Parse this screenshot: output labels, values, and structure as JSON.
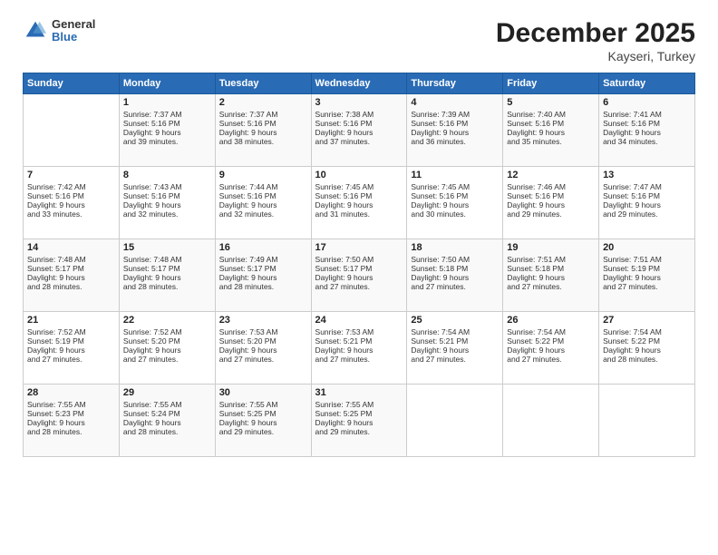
{
  "header": {
    "logo_general": "General",
    "logo_blue": "Blue",
    "month": "December 2025",
    "location": "Kayseri, Turkey"
  },
  "days_of_week": [
    "Sunday",
    "Monday",
    "Tuesday",
    "Wednesday",
    "Thursday",
    "Friday",
    "Saturday"
  ],
  "weeks": [
    [
      {
        "day": "",
        "content": ""
      },
      {
        "day": "1",
        "content": "Sunrise: 7:37 AM\nSunset: 5:16 PM\nDaylight: 9 hours\nand 39 minutes."
      },
      {
        "day": "2",
        "content": "Sunrise: 7:37 AM\nSunset: 5:16 PM\nDaylight: 9 hours\nand 38 minutes."
      },
      {
        "day": "3",
        "content": "Sunrise: 7:38 AM\nSunset: 5:16 PM\nDaylight: 9 hours\nand 37 minutes."
      },
      {
        "day": "4",
        "content": "Sunrise: 7:39 AM\nSunset: 5:16 PM\nDaylight: 9 hours\nand 36 minutes."
      },
      {
        "day": "5",
        "content": "Sunrise: 7:40 AM\nSunset: 5:16 PM\nDaylight: 9 hours\nand 35 minutes."
      },
      {
        "day": "6",
        "content": "Sunrise: 7:41 AM\nSunset: 5:16 PM\nDaylight: 9 hours\nand 34 minutes."
      }
    ],
    [
      {
        "day": "7",
        "content": "Sunrise: 7:42 AM\nSunset: 5:16 PM\nDaylight: 9 hours\nand 33 minutes."
      },
      {
        "day": "8",
        "content": "Sunrise: 7:43 AM\nSunset: 5:16 PM\nDaylight: 9 hours\nand 32 minutes."
      },
      {
        "day": "9",
        "content": "Sunrise: 7:44 AM\nSunset: 5:16 PM\nDaylight: 9 hours\nand 32 minutes."
      },
      {
        "day": "10",
        "content": "Sunrise: 7:45 AM\nSunset: 5:16 PM\nDaylight: 9 hours\nand 31 minutes."
      },
      {
        "day": "11",
        "content": "Sunrise: 7:45 AM\nSunset: 5:16 PM\nDaylight: 9 hours\nand 30 minutes."
      },
      {
        "day": "12",
        "content": "Sunrise: 7:46 AM\nSunset: 5:16 PM\nDaylight: 9 hours\nand 29 minutes."
      },
      {
        "day": "13",
        "content": "Sunrise: 7:47 AM\nSunset: 5:16 PM\nDaylight: 9 hours\nand 29 minutes."
      }
    ],
    [
      {
        "day": "14",
        "content": "Sunrise: 7:48 AM\nSunset: 5:17 PM\nDaylight: 9 hours\nand 28 minutes."
      },
      {
        "day": "15",
        "content": "Sunrise: 7:48 AM\nSunset: 5:17 PM\nDaylight: 9 hours\nand 28 minutes."
      },
      {
        "day": "16",
        "content": "Sunrise: 7:49 AM\nSunset: 5:17 PM\nDaylight: 9 hours\nand 28 minutes."
      },
      {
        "day": "17",
        "content": "Sunrise: 7:50 AM\nSunset: 5:17 PM\nDaylight: 9 hours\nand 27 minutes."
      },
      {
        "day": "18",
        "content": "Sunrise: 7:50 AM\nSunset: 5:18 PM\nDaylight: 9 hours\nand 27 minutes."
      },
      {
        "day": "19",
        "content": "Sunrise: 7:51 AM\nSunset: 5:18 PM\nDaylight: 9 hours\nand 27 minutes."
      },
      {
        "day": "20",
        "content": "Sunrise: 7:51 AM\nSunset: 5:19 PM\nDaylight: 9 hours\nand 27 minutes."
      }
    ],
    [
      {
        "day": "21",
        "content": "Sunrise: 7:52 AM\nSunset: 5:19 PM\nDaylight: 9 hours\nand 27 minutes."
      },
      {
        "day": "22",
        "content": "Sunrise: 7:52 AM\nSunset: 5:20 PM\nDaylight: 9 hours\nand 27 minutes."
      },
      {
        "day": "23",
        "content": "Sunrise: 7:53 AM\nSunset: 5:20 PM\nDaylight: 9 hours\nand 27 minutes."
      },
      {
        "day": "24",
        "content": "Sunrise: 7:53 AM\nSunset: 5:21 PM\nDaylight: 9 hours\nand 27 minutes."
      },
      {
        "day": "25",
        "content": "Sunrise: 7:54 AM\nSunset: 5:21 PM\nDaylight: 9 hours\nand 27 minutes."
      },
      {
        "day": "26",
        "content": "Sunrise: 7:54 AM\nSunset: 5:22 PM\nDaylight: 9 hours\nand 27 minutes."
      },
      {
        "day": "27",
        "content": "Sunrise: 7:54 AM\nSunset: 5:22 PM\nDaylight: 9 hours\nand 28 minutes."
      }
    ],
    [
      {
        "day": "28",
        "content": "Sunrise: 7:55 AM\nSunset: 5:23 PM\nDaylight: 9 hours\nand 28 minutes."
      },
      {
        "day": "29",
        "content": "Sunrise: 7:55 AM\nSunset: 5:24 PM\nDaylight: 9 hours\nand 28 minutes."
      },
      {
        "day": "30",
        "content": "Sunrise: 7:55 AM\nSunset: 5:25 PM\nDaylight: 9 hours\nand 29 minutes."
      },
      {
        "day": "31",
        "content": "Sunrise: 7:55 AM\nSunset: 5:25 PM\nDaylight: 9 hours\nand 29 minutes."
      },
      {
        "day": "",
        "content": ""
      },
      {
        "day": "",
        "content": ""
      },
      {
        "day": "",
        "content": ""
      }
    ]
  ]
}
